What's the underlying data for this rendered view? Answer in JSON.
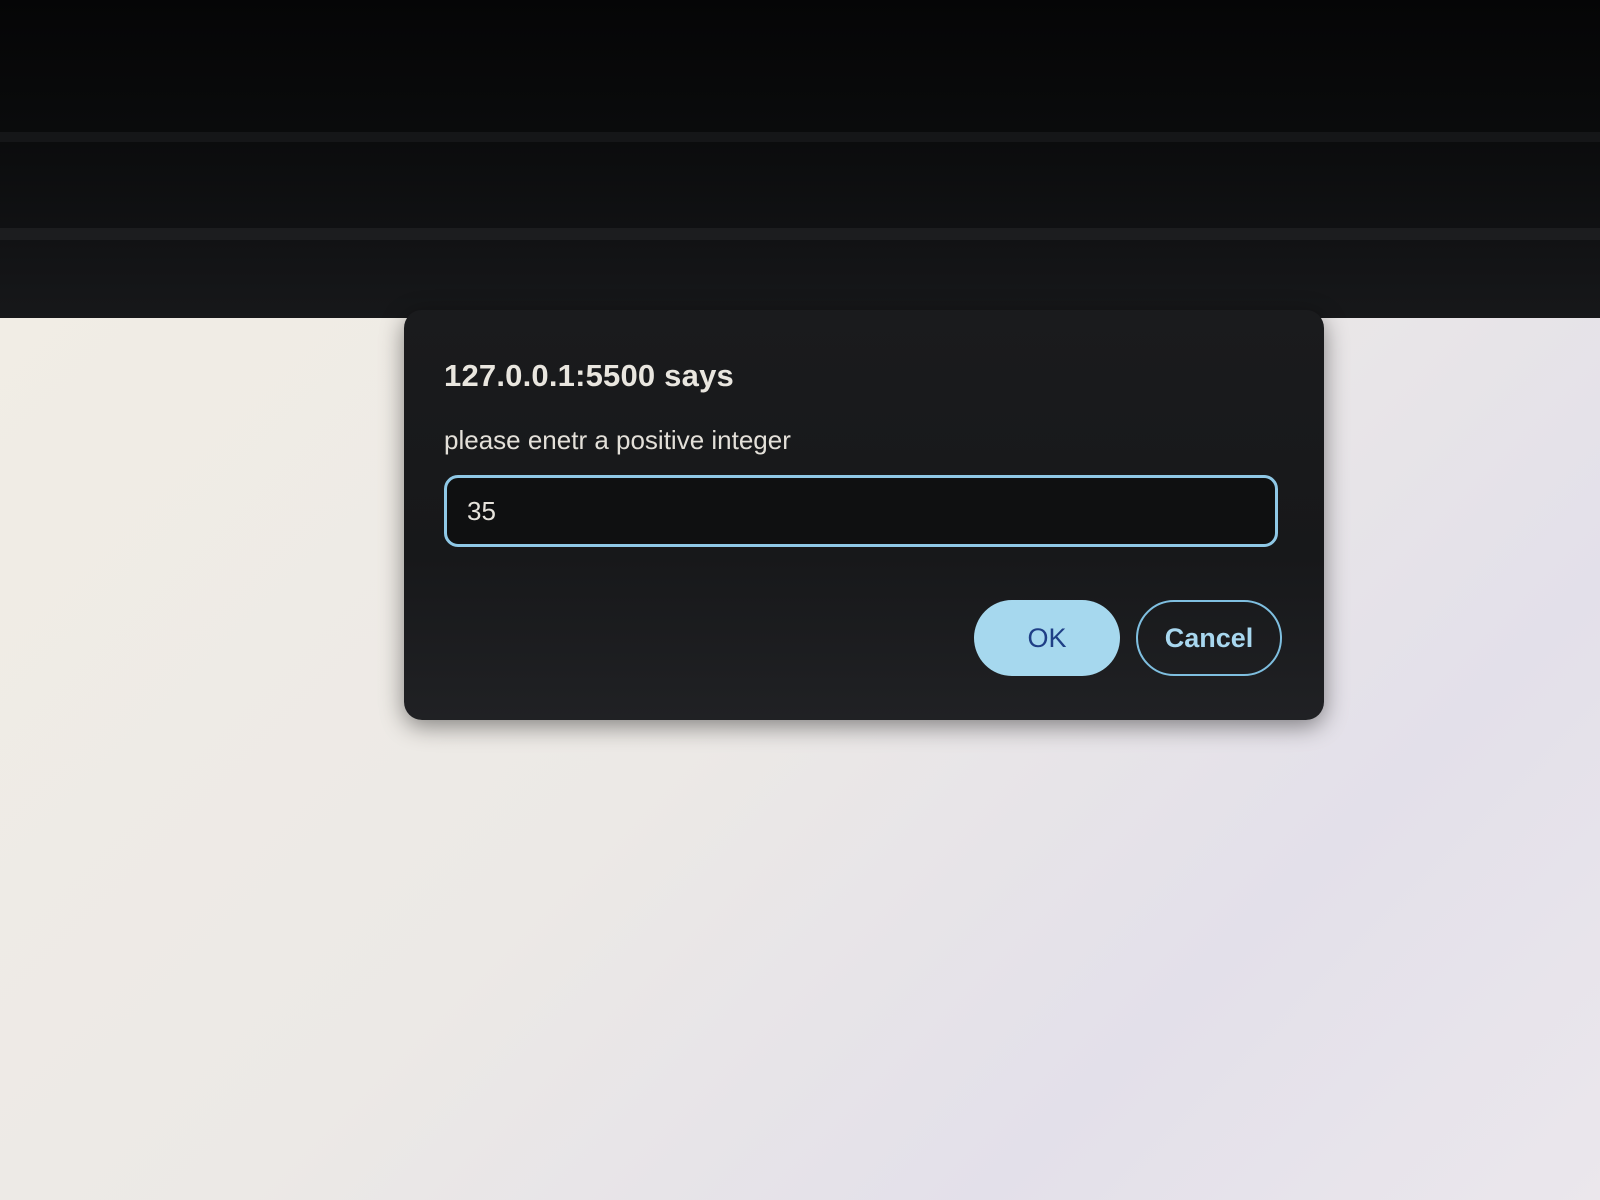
{
  "dialog": {
    "title": "127.0.0.1:5500 says",
    "message": "please enetr a positive integer",
    "input_value": "35",
    "ok_label": "OK",
    "cancel_label": "Cancel"
  },
  "colors": {
    "dialog_background": "#1a1b1d",
    "input_border": "#8fc8e6",
    "ok_button_background": "#a6d8ee",
    "ok_button_text": "#1f3f86",
    "cancel_button_border": "#7fbfe0",
    "page_background": "#eeebe6"
  }
}
